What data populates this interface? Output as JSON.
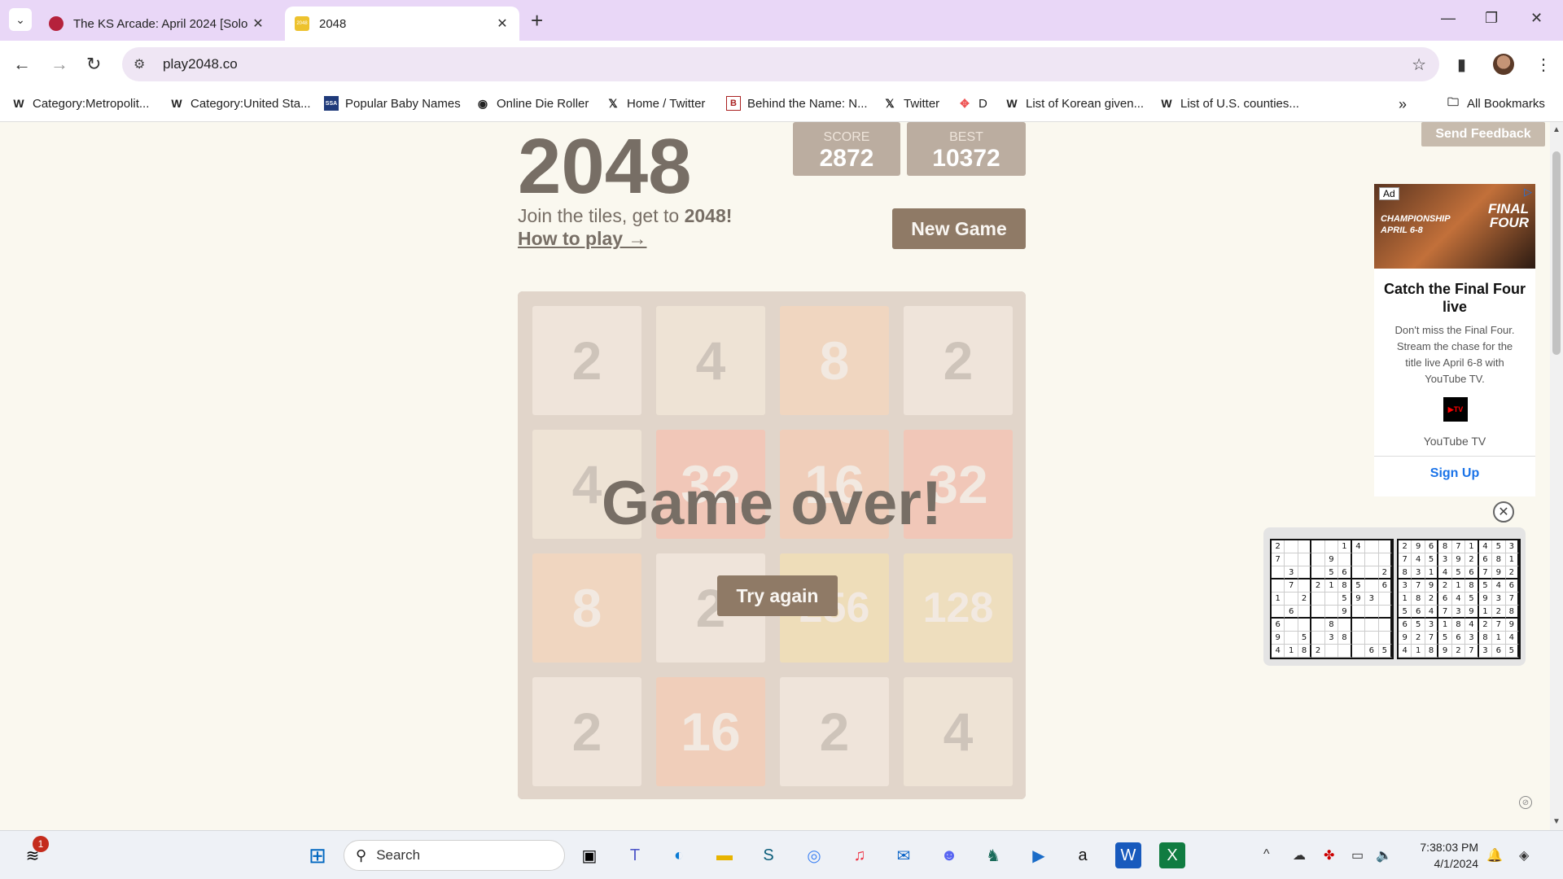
{
  "browser": {
    "tabs": [
      {
        "title": "The KS Arcade: April 2024 [Solo",
        "favicon_color": "#b5223c"
      },
      {
        "title": "2048",
        "favicon_color": "#edc22e",
        "favicon_text": "2048"
      }
    ],
    "url": "play2048.co",
    "bookmarks": [
      {
        "label": "Category:Metropolit...",
        "icon": "W"
      },
      {
        "label": "Category:United Sta...",
        "icon": "W"
      },
      {
        "label": "Popular Baby Names",
        "icon": "SSA"
      },
      {
        "label": "Online Die Roller",
        "icon": "globe"
      },
      {
        "label": "Home / Twitter",
        "icon": "X"
      },
      {
        "label": "Behind the Name: N...",
        "icon": "B"
      },
      {
        "label": "Twitter",
        "icon": "X"
      },
      {
        "label": "D",
        "icon": "pinwheel"
      },
      {
        "label": "List of Korean given...",
        "icon": "W"
      },
      {
        "label": "List of U.S. counties...",
        "icon": "W"
      }
    ],
    "all_bookmarks": "All Bookmarks"
  },
  "game": {
    "title": "2048",
    "score_label": "SCORE",
    "score": "2872",
    "best_label": "BEST",
    "best": "10372",
    "intro_prefix": "Join the tiles, get to ",
    "intro_goal": "2048!",
    "how_to_play": "How to play →",
    "new_game": "New Game",
    "game_over": "Game over!",
    "try_again": "Try again",
    "grid": [
      [
        "2",
        "4",
        "8",
        "2"
      ],
      [
        "4",
        "32",
        "16",
        "32"
      ],
      [
        "8",
        "2",
        "256",
        "128"
      ],
      [
        "2",
        "16",
        "2",
        "4"
      ]
    ]
  },
  "feedback": "Send Feedback",
  "ad": {
    "badge": "Ad",
    "image_text": "FINAL FOUR",
    "image_text2": "CHAMPIONSHIP APRIL 6-8",
    "title": "Catch the Final Four live",
    "description": "Don't miss the Final Four. Stream the chase for the title live April 6-8 with YouTube TV.",
    "logo_text": "▶TV",
    "brand": "YouTube TV",
    "cta": "Sign Up"
  },
  "sudoku": {
    "left": [
      "2",
      "",
      "",
      "",
      "",
      "1",
      "4",
      "",
      "",
      "7",
      "",
      "",
      "",
      "9",
      "",
      "",
      "",
      "",
      "",
      "3",
      "",
      "",
      "5",
      "6",
      "",
      "",
      "2",
      "",
      "7",
      "",
      "2",
      "1",
      "8",
      "5",
      "",
      "6",
      "1",
      "",
      "2",
      "",
      "",
      "5",
      "9",
      "3",
      "",
      "",
      "6",
      "",
      "",
      "",
      "9",
      "",
      "",
      "",
      "6",
      "",
      "",
      "",
      "8",
      "",
      "",
      "",
      "",
      "9",
      "",
      "5",
      "",
      "3",
      "8",
      "",
      "",
      "",
      "4",
      "1",
      "8",
      "2",
      "",
      "",
      "",
      "6",
      "5"
    ],
    "right": [
      "2",
      "9",
      "6",
      "8",
      "7",
      "1",
      "4",
      "5",
      "3",
      "7",
      "4",
      "5",
      "3",
      "9",
      "2",
      "6",
      "8",
      "1",
      "8",
      "3",
      "1",
      "4",
      "5",
      "6",
      "7",
      "9",
      "2",
      "3",
      "7",
      "9",
      "2",
      "1",
      "8",
      "5",
      "4",
      "6",
      "1",
      "8",
      "2",
      "6",
      "4",
      "5",
      "9",
      "3",
      "7",
      "5",
      "6",
      "4",
      "7",
      "3",
      "9",
      "1",
      "2",
      "8",
      "6",
      "5",
      "3",
      "1",
      "8",
      "4",
      "2",
      "7",
      "9",
      "9",
      "2",
      "7",
      "5",
      "6",
      "3",
      "8",
      "1",
      "4",
      "4",
      "1",
      "8",
      "9",
      "2",
      "7",
      "3",
      "6",
      "5"
    ]
  },
  "taskbar": {
    "search_placeholder": "Search",
    "notification_count": "1",
    "time": "7:38:03 PM",
    "date": "4/1/2024"
  }
}
